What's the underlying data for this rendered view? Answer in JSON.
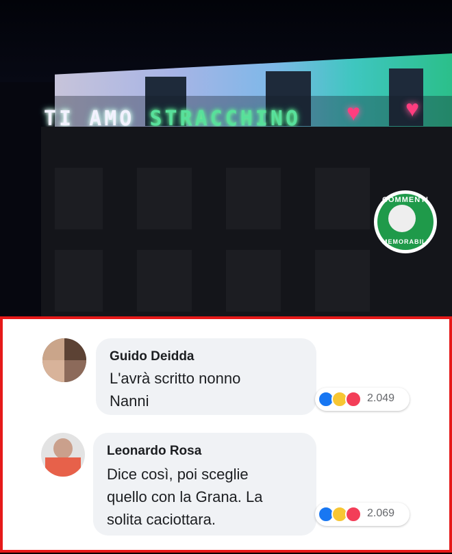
{
  "photo": {
    "led_white": "TI AMO ",
    "led_green": "STRACCHINO",
    "watermark_top": "COMMENTI",
    "watermark_bottom": "MEMORABILI"
  },
  "comments": [
    {
      "author": "Guido Deidda",
      "text_line1": "L'avrà scritto nonno",
      "text_line2": "Nanni",
      "reactions": [
        "like-icon",
        "haha-icon",
        "love-icon"
      ],
      "reaction_count": "2.049"
    },
    {
      "author": "Leonardo Rosa",
      "text_line1": "Dice così, poi sceglie",
      "text_line2": "quello con la Grana. La",
      "text_line3": "solita caciottara.",
      "reactions": [
        "like-icon",
        "haha-icon",
        "love-icon"
      ],
      "reaction_count": "2.069"
    }
  ],
  "colors": {
    "frame": "#e61919",
    "bubble": "#f0f2f5",
    "like": "#1877f2",
    "love": "#f33e58",
    "haha": "#f7c633"
  }
}
